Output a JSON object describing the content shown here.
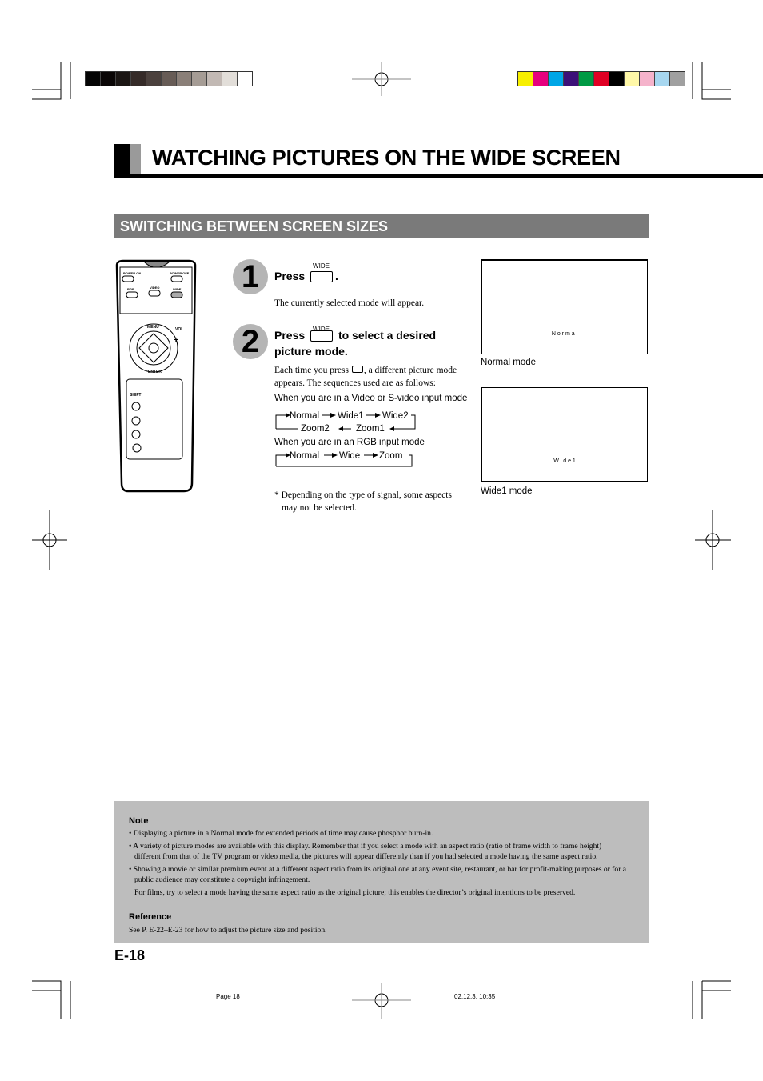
{
  "print_marks": {
    "gray_swatches": [
      "#050505",
      "#0a0606",
      "#1b1614",
      "#352b28",
      "#4b413d",
      "#675c56",
      "#8a7f78",
      "#a59c95",
      "#c2b9b4",
      "#e2ded9",
      "#ffffff"
    ],
    "color_swatches": [
      "#f7ef00",
      "#e6007e",
      "#00a6e6",
      "#3c1078",
      "#009a44",
      "#e00024",
      "#000000",
      "#fff8a8",
      "#f5b3cb",
      "#a7d7f0",
      "#a0a0a0"
    ]
  },
  "page_title": "WATCHING PICTURES ON THE WIDE SCREEN",
  "section_title": "SWITCHING BETWEEN SCREEN SIZES",
  "remote": {
    "power_on": "POWER ON",
    "power_off": "POWER OFF",
    "rgb": "RGB",
    "video": "VIDEO",
    "wide": "WIDE",
    "menu": "MENU",
    "vol": "VOL",
    "enter": "ENTER",
    "shift": "SHIFT",
    "numbers": [
      "1",
      "2",
      "3",
      "4"
    ]
  },
  "steps": [
    {
      "number": "1",
      "heading_pre": "Press",
      "heading_post": ".",
      "button": "WIDE",
      "text": "The currently selected mode will appear."
    },
    {
      "number": "2",
      "heading_pre": "Press",
      "heading_post": "to select a desired",
      "heading_line2": "picture mode.",
      "button": "WIDE",
      "text_pre": "Each time you press",
      "text_post": ", a different picture mode",
      "text_line2": "appears.  The sequences used are as follows:"
    }
  ],
  "video_sequence": {
    "label": "When you are in a Video or S-video input mode",
    "row1": [
      "Normal",
      "Wide1",
      "Wide2"
    ],
    "row2": [
      "Zoom2",
      "Zoom1"
    ]
  },
  "rgb_sequence": {
    "label": "When you are in an RGB input mode",
    "row1": [
      "Normal",
      "Wide",
      "Zoom"
    ]
  },
  "footnote_line1": "* Depending on the type of signal, some aspects",
  "footnote_line2": "may not be selected.",
  "screens": [
    {
      "onscreen": "N o r m a l",
      "caption": "Normal mode"
    },
    {
      "onscreen": "W i d e 1",
      "caption": "Wide1 mode"
    }
  ],
  "note": {
    "title": "Note",
    "bullets": [
      "Displaying a picture in a Normal mode for extended periods of time may cause phosphor burn-in.",
      "A variety of picture modes are available with this display.  Remember that if you select a mode with an aspect ratio (ratio of frame width to frame height) different from that of the TV program or video media, the pictures will appear differently than if you had selected a mode having the same aspect ratio.",
      "Showing a movie or similar premium event at a different aspect ratio from its original one at any event site, restaurant, or bar for profit-making purposes or for a public audience may constitute a copyright infringement."
    ],
    "extra": "For films, try to select a mode having the same aspect ratio as the original picture; this enables the director’s original intentions to be preserved.",
    "reference_title": "Reference",
    "reference_text": "See P. E-22–E-23 for how to adjust the picture size and position."
  },
  "page_number": "E-18",
  "footer": {
    "page": "Page 18",
    "timestamp": "02.12.3, 10:35"
  }
}
